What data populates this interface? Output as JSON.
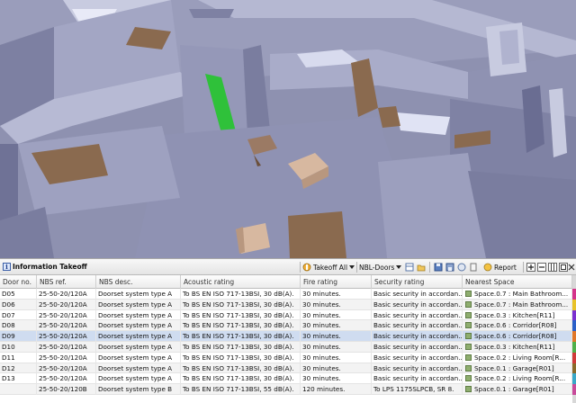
{
  "panel": {
    "title": "Information Takeoff",
    "info_icon": "i",
    "takeoff_all_label": "Takeoff All",
    "nbl_doors_label": "NBL-Doors",
    "report_label": "Report"
  },
  "icons": [
    "info-icon",
    "takeoff-icon",
    "open-folder-icon",
    "save-icon",
    "report-icon",
    "add-icon",
    "remove-icon",
    "columns-icon",
    "restore-icon",
    "close-icon"
  ],
  "table": {
    "columns": [
      "Door no.",
      "NBS ref.",
      "NBS desc.",
      "Acoustic rating",
      "Fire rating",
      "Security rating",
      "Nearest Space"
    ],
    "rows": [
      {
        "door": "D05",
        "ref": "25-50-20/120A",
        "desc": "Doorset system type A",
        "acoustic": "To BS EN ISO 717-13BSI, 30 dB(A).",
        "fire": "30 minutes.",
        "security": "Basic security in accordan...",
        "space": "Space.0.7 : Main Bathroom..."
      },
      {
        "door": "D06",
        "ref": "25-50-20/120A",
        "desc": "Doorset system type A",
        "acoustic": "To BS EN ISO 717-13BSI, 30 dB(A).",
        "fire": "30 minutes.",
        "security": "Basic security in accordan...",
        "space": "Space.0.7 : Main Bathroom..."
      },
      {
        "door": "D07",
        "ref": "25-50-20/120A",
        "desc": "Doorset system type A",
        "acoustic": "To BS EN ISO 717-13BSI, 30 dB(A).",
        "fire": "30 minutes.",
        "security": "Basic security in accordan...",
        "space": "Space.0.3 : Kitchen[R11]"
      },
      {
        "door": "D08",
        "ref": "25-50-20/120A",
        "desc": "Doorset system type A",
        "acoustic": "To BS EN ISO 717-13BSI, 30 dB(A).",
        "fire": "30 minutes.",
        "security": "Basic security in accordan...",
        "space": "Space.0.6 : Corridor[R08]"
      },
      {
        "door": "D09",
        "ref": "25-50-20/120A",
        "desc": "Doorset system type A",
        "acoustic": "To BS EN ISO 717-13BSI, 30 dB(A).",
        "fire": "30 minutes.",
        "security": "Basic security in accordan...",
        "space": "Space.0.6 : Corridor[R08]"
      },
      {
        "door": "D10",
        "ref": "25-50-20/120A",
        "desc": "Doorset system type A",
        "acoustic": "To BS EN ISO 717-13BSI, 30 dB(A).",
        "fire": "30 minutes.",
        "security": "Basic security in accordan...",
        "space": "Space.0.3 : Kitchen[R11]"
      },
      {
        "door": "D11",
        "ref": "25-50-20/120A",
        "desc": "Doorset system type A",
        "acoustic": "To BS EN ISO 717-13BSI, 30 dB(A).",
        "fire": "30 minutes.",
        "security": "Basic security in accordan...",
        "space": "Space.0.2 : Living Room[R..."
      },
      {
        "door": "D12",
        "ref": "25-50-20/120A",
        "desc": "Doorset system type A",
        "acoustic": "To BS EN ISO 717-13BSI, 30 dB(A).",
        "fire": "30 minutes.",
        "security": "Basic security in accordan...",
        "space": "Space.0.1 : Garage[R01]"
      },
      {
        "door": "D13",
        "ref": "25-50-20/120A",
        "desc": "Doorset system type A",
        "acoustic": "To BS EN ISO 717-13BSI, 30 dB(A).",
        "fire": "30 minutes.",
        "security": "Basic security in accordan...",
        "space": "Space.0.2 : Living Room[R..."
      },
      {
        "door": "",
        "ref": "25-50-20/120B",
        "desc": "Doorset system type B",
        "acoustic": "To BS EN ISO 717-13BSI, 55 dB(A).",
        "fire": "120 minutes.",
        "security": "To LPS 1175SLPCB, SR 8.",
        "space": "Space.0.1 : Garage[R01]"
      }
    ],
    "selected_index": 4
  },
  "colors": {
    "row_selected": "#cfdcf0",
    "strip": [
      "#d4338a",
      "#e8c22a",
      "#7a2fd0",
      "#2a60c8",
      "#e0782a",
      "#4fb04a",
      "#d03a3a",
      "#8a6a2a",
      "#3aa8c8",
      "#c84a9a"
    ]
  }
}
